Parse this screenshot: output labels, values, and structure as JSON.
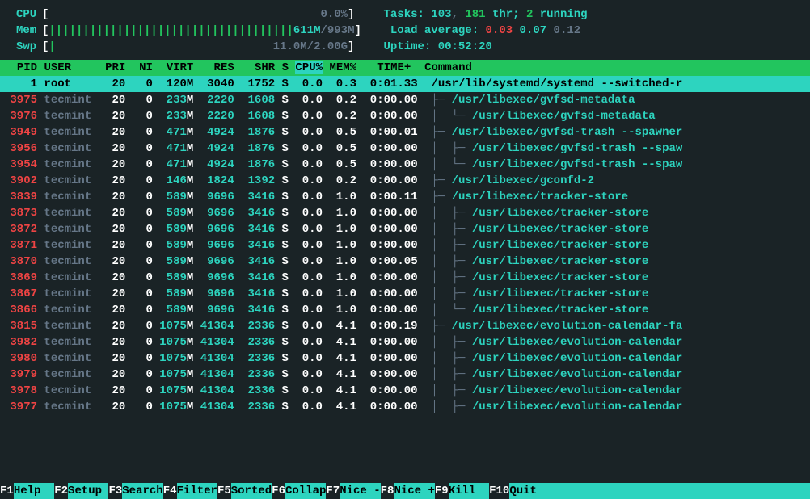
{
  "meters": {
    "cpu": {
      "label": "CPU",
      "bar": "",
      "text": "0.0%"
    },
    "mem": {
      "label": "Mem",
      "bar": "||||||||||||||||||||||||||||||||||||",
      "used": "611M",
      "total": "993M"
    },
    "swp": {
      "label": "Swp",
      "bar": "|",
      "text": "11.0M/2.00G"
    }
  },
  "stats": {
    "tasks_label": "Tasks: ",
    "tasks": "103",
    "thr": "181",
    "thr_lbl": " thr; ",
    "running": "2",
    "running_lbl": " running",
    "la_label": "Load average: ",
    "la1": "0.03",
    "la2": "0.07",
    "la3": "0.12",
    "up_label": "Uptime: ",
    "uptime": "00:52:20"
  },
  "columns": {
    "pid": "PID",
    "user": "USER",
    "pri": "PRI",
    "ni": "NI",
    "virt": "VIRT",
    "res": "RES",
    "shr": "SHR",
    "s": "S",
    "cpu": "CPU%",
    "mem": "MEM%",
    "time": "TIME+",
    "command": "Command"
  },
  "processes": [
    {
      "pid": "1",
      "user": "root",
      "pri": "20",
      "ni": "0",
      "virt": "120M",
      "res": "3040",
      "shr": "1752",
      "s": "S",
      "cpu": "0.0",
      "mem": "0.3",
      "time": "0:01.33",
      "cmd": "/usr/lib/systemd/systemd --switched-r",
      "tree": "",
      "sel": true
    },
    {
      "pid": "3975",
      "user": "tecmint",
      "pri": "20",
      "ni": "0",
      "virt": "233M",
      "res": "2220",
      "shr": "1608",
      "s": "S",
      "cpu": "0.0",
      "mem": "0.2",
      "time": "0:00.00",
      "cmd": "/usr/libexec/gvfsd-metadata",
      "tree": "├─ "
    },
    {
      "pid": "3976",
      "user": "tecmint",
      "pri": "20",
      "ni": "0",
      "virt": "233M",
      "res": "2220",
      "shr": "1608",
      "s": "S",
      "cpu": "0.0",
      "mem": "0.2",
      "time": "0:00.00",
      "cmd": "/usr/libexec/gvfsd-metadata",
      "tree": "│  └─ ",
      "sub": true
    },
    {
      "pid": "3949",
      "user": "tecmint",
      "pri": "20",
      "ni": "0",
      "virt": "471M",
      "res": "4924",
      "shr": "1876",
      "s": "S",
      "cpu": "0.0",
      "mem": "0.5",
      "time": "0:00.01",
      "cmd": "/usr/libexec/gvfsd-trash --spawner",
      "tree": "├─ "
    },
    {
      "pid": "3956",
      "user": "tecmint",
      "pri": "20",
      "ni": "0",
      "virt": "471M",
      "res": "4924",
      "shr": "1876",
      "s": "S",
      "cpu": "0.0",
      "mem": "0.5",
      "time": "0:00.00",
      "cmd": "/usr/libexec/gvfsd-trash --spaw",
      "tree": "│  ├─ ",
      "sub": true
    },
    {
      "pid": "3954",
      "user": "tecmint",
      "pri": "20",
      "ni": "0",
      "virt": "471M",
      "res": "4924",
      "shr": "1876",
      "s": "S",
      "cpu": "0.0",
      "mem": "0.5",
      "time": "0:00.00",
      "cmd": "/usr/libexec/gvfsd-trash --spaw",
      "tree": "│  └─ ",
      "sub": true
    },
    {
      "pid": "3902",
      "user": "tecmint",
      "pri": "20",
      "ni": "0",
      "virt": "146M",
      "res": "1824",
      "shr": "1392",
      "s": "S",
      "cpu": "0.0",
      "mem": "0.2",
      "time": "0:00.00",
      "cmd": "/usr/libexec/gconfd-2",
      "tree": "├─ "
    },
    {
      "pid": "3839",
      "user": "tecmint",
      "pri": "20",
      "ni": "0",
      "virt": "589M",
      "res": "9696",
      "shr": "3416",
      "s": "S",
      "cpu": "0.0",
      "mem": "1.0",
      "time": "0:00.11",
      "cmd": "/usr/libexec/tracker-store",
      "tree": "├─ "
    },
    {
      "pid": "3873",
      "user": "tecmint",
      "pri": "20",
      "ni": "0",
      "virt": "589M",
      "res": "9696",
      "shr": "3416",
      "s": "S",
      "cpu": "0.0",
      "mem": "1.0",
      "time": "0:00.00",
      "cmd": "/usr/libexec/tracker-store",
      "tree": "│  ├─ ",
      "sub": true
    },
    {
      "pid": "3872",
      "user": "tecmint",
      "pri": "20",
      "ni": "0",
      "virt": "589M",
      "res": "9696",
      "shr": "3416",
      "s": "S",
      "cpu": "0.0",
      "mem": "1.0",
      "time": "0:00.00",
      "cmd": "/usr/libexec/tracker-store",
      "tree": "│  ├─ ",
      "sub": true
    },
    {
      "pid": "3871",
      "user": "tecmint",
      "pri": "20",
      "ni": "0",
      "virt": "589M",
      "res": "9696",
      "shr": "3416",
      "s": "S",
      "cpu": "0.0",
      "mem": "1.0",
      "time": "0:00.00",
      "cmd": "/usr/libexec/tracker-store",
      "tree": "│  ├─ ",
      "sub": true
    },
    {
      "pid": "3870",
      "user": "tecmint",
      "pri": "20",
      "ni": "0",
      "virt": "589M",
      "res": "9696",
      "shr": "3416",
      "s": "S",
      "cpu": "0.0",
      "mem": "1.0",
      "time": "0:00.05",
      "cmd": "/usr/libexec/tracker-store",
      "tree": "│  ├─ ",
      "sub": true
    },
    {
      "pid": "3869",
      "user": "tecmint",
      "pri": "20",
      "ni": "0",
      "virt": "589M",
      "res": "9696",
      "shr": "3416",
      "s": "S",
      "cpu": "0.0",
      "mem": "1.0",
      "time": "0:00.00",
      "cmd": "/usr/libexec/tracker-store",
      "tree": "│  ├─ ",
      "sub": true
    },
    {
      "pid": "3867",
      "user": "tecmint",
      "pri": "20",
      "ni": "0",
      "virt": "589M",
      "res": "9696",
      "shr": "3416",
      "s": "S",
      "cpu": "0.0",
      "mem": "1.0",
      "time": "0:00.00",
      "cmd": "/usr/libexec/tracker-store",
      "tree": "│  ├─ ",
      "sub": true
    },
    {
      "pid": "3866",
      "user": "tecmint",
      "pri": "20",
      "ni": "0",
      "virt": "589M",
      "res": "9696",
      "shr": "3416",
      "s": "S",
      "cpu": "0.0",
      "mem": "1.0",
      "time": "0:00.00",
      "cmd": "/usr/libexec/tracker-store",
      "tree": "│  └─ ",
      "sub": true
    },
    {
      "pid": "3815",
      "user": "tecmint",
      "pri": "20",
      "ni": "0",
      "virt": "1075M",
      "res": "41304",
      "shr": "2336",
      "s": "S",
      "cpu": "0.0",
      "mem": "4.1",
      "time": "0:00.19",
      "cmd": "/usr/libexec/evolution-calendar-fa",
      "tree": "├─ "
    },
    {
      "pid": "3982",
      "user": "tecmint",
      "pri": "20",
      "ni": "0",
      "virt": "1075M",
      "res": "41304",
      "shr": "2336",
      "s": "S",
      "cpu": "0.0",
      "mem": "4.1",
      "time": "0:00.00",
      "cmd": "/usr/libexec/evolution-calendar",
      "tree": "│  ├─ ",
      "sub": true
    },
    {
      "pid": "3980",
      "user": "tecmint",
      "pri": "20",
      "ni": "0",
      "virt": "1075M",
      "res": "41304",
      "shr": "2336",
      "s": "S",
      "cpu": "0.0",
      "mem": "4.1",
      "time": "0:00.00",
      "cmd": "/usr/libexec/evolution-calendar",
      "tree": "│  ├─ ",
      "sub": true
    },
    {
      "pid": "3979",
      "user": "tecmint",
      "pri": "20",
      "ni": "0",
      "virt": "1075M",
      "res": "41304",
      "shr": "2336",
      "s": "S",
      "cpu": "0.0",
      "mem": "4.1",
      "time": "0:00.00",
      "cmd": "/usr/libexec/evolution-calendar",
      "tree": "│  ├─ ",
      "sub": true
    },
    {
      "pid": "3978",
      "user": "tecmint",
      "pri": "20",
      "ni": "0",
      "virt": "1075M",
      "res": "41304",
      "shr": "2336",
      "s": "S",
      "cpu": "0.0",
      "mem": "4.1",
      "time": "0:00.00",
      "cmd": "/usr/libexec/evolution-calendar",
      "tree": "│  ├─ ",
      "sub": true
    },
    {
      "pid": "3977",
      "user": "tecmint",
      "pri": "20",
      "ni": "0",
      "virt": "1075M",
      "res": "41304",
      "shr": "2336",
      "s": "S",
      "cpu": "0.0",
      "mem": "4.1",
      "time": "0:00.00",
      "cmd": "/usr/libexec/evolution-calendar",
      "tree": "│  ├─ ",
      "sub": true
    }
  ],
  "footer": [
    {
      "key": "F1",
      "label": "Help  "
    },
    {
      "key": "F2",
      "label": "Setup "
    },
    {
      "key": "F3",
      "label": "Search"
    },
    {
      "key": "F4",
      "label": "Filter"
    },
    {
      "key": "F5",
      "label": "Sorted"
    },
    {
      "key": "F6",
      "label": "Collap"
    },
    {
      "key": "F7",
      "label": "Nice -"
    },
    {
      "key": "F8",
      "label": "Nice +"
    },
    {
      "key": "F9",
      "label": "Kill  "
    },
    {
      "key": "F10",
      "label": "Quit  "
    }
  ]
}
